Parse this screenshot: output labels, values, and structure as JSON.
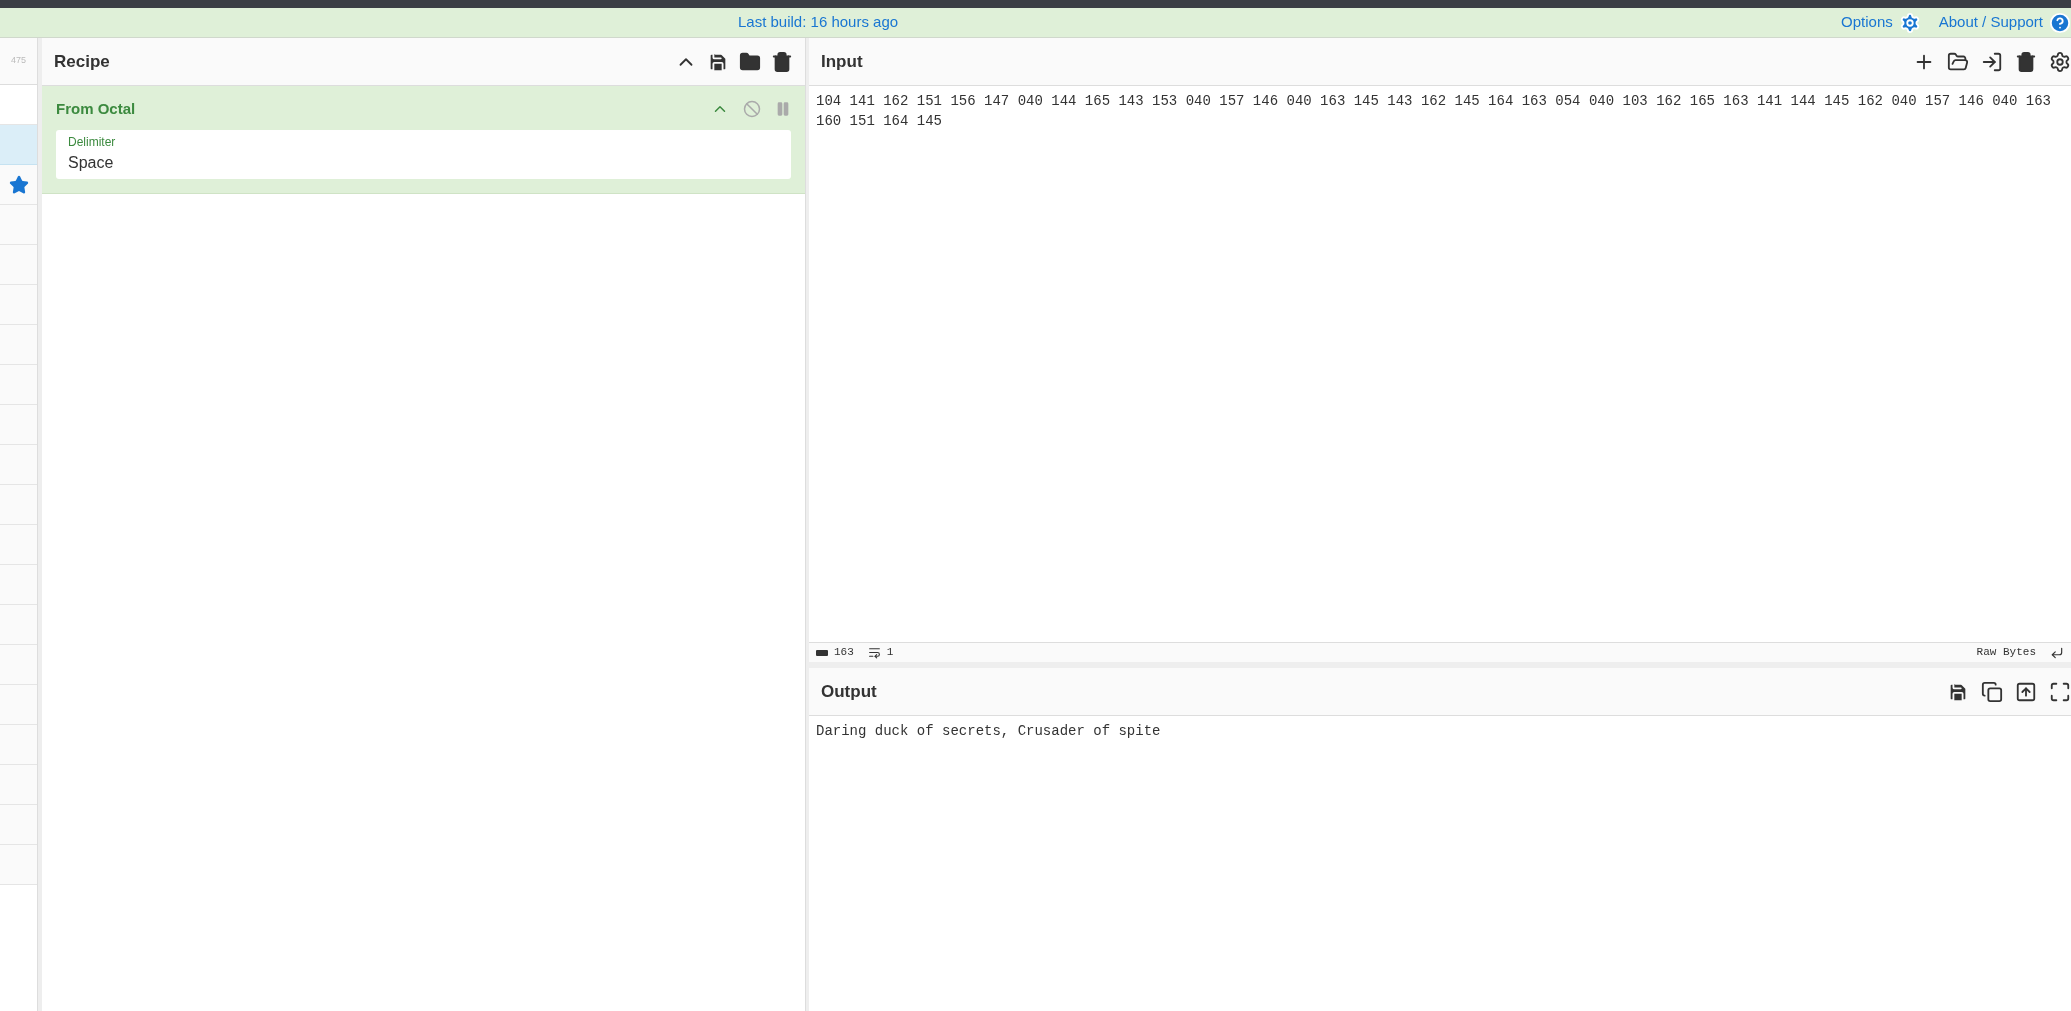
{
  "banner": {
    "build": "Last build: 16 hours ago",
    "links": [
      "Options",
      "About / Support"
    ]
  },
  "operations": {
    "count": "475",
    "rows": [
      {
        "kind": "search",
        "selected": false
      },
      {
        "kind": "category",
        "selected": true
      },
      {
        "kind": "favourites",
        "selected": false
      },
      {
        "kind": "category",
        "selected": false
      },
      {
        "kind": "category",
        "selected": false
      },
      {
        "kind": "category",
        "selected": false
      },
      {
        "kind": "category",
        "selected": false
      },
      {
        "kind": "category",
        "selected": false
      },
      {
        "kind": "category",
        "selected": false
      },
      {
        "kind": "category",
        "selected": false
      },
      {
        "kind": "category",
        "selected": false
      },
      {
        "kind": "category",
        "selected": false
      },
      {
        "kind": "category",
        "selected": false
      },
      {
        "kind": "category",
        "selected": false
      },
      {
        "kind": "category",
        "selected": false
      },
      {
        "kind": "category",
        "selected": false
      },
      {
        "kind": "category",
        "selected": false
      },
      {
        "kind": "category",
        "selected": false
      },
      {
        "kind": "category",
        "selected": false
      },
      {
        "kind": "category",
        "selected": false
      }
    ]
  },
  "recipe": {
    "title": "Recipe",
    "operations": [
      {
        "name": "From Octal",
        "disabled": false,
        "paused": false,
        "field": {
          "label": "Delimiter",
          "value": "Space"
        }
      }
    ]
  },
  "input": {
    "title": "Input",
    "text": "104 141 162 151 156 147 040 144 165 143 153 040 157 146 040 163 145 143 162 145 164 163 054 040 103 162 165 163 141 144 145 162 040 157 146 040 163 160 151 164 145",
    "length": "163",
    "lines": "1",
    "encoding": "Raw Bytes"
  },
  "output": {
    "title": "Output",
    "text": "Daring duck of secrets, Crusader of spite"
  }
}
